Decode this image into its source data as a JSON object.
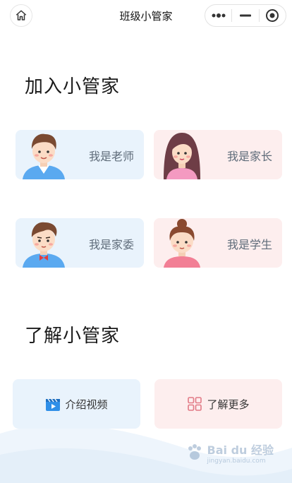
{
  "navbar": {
    "title": "班级小管家",
    "home_icon": "home-icon",
    "more_icon": "more-dots-icon",
    "minimize_icon": "minimize-icon",
    "close_icon": "target-close-icon"
  },
  "join_section": {
    "title": "加入小管家",
    "roles": [
      {
        "label": "我是老师",
        "avatar": "teacher-avatar",
        "theme": "blue"
      },
      {
        "label": "我是家长",
        "avatar": "parent-avatar",
        "theme": "pink"
      },
      {
        "label": "我是家委",
        "avatar": "committee-avatar",
        "theme": "blue"
      },
      {
        "label": "我是学生",
        "avatar": "student-avatar",
        "theme": "pink"
      }
    ]
  },
  "learn_section": {
    "title": "了解小管家",
    "video_label": "介绍视频",
    "more_label": "了解更多"
  },
  "watermark": {
    "text": "Bai du 经验",
    "subtext": "jingyan.baidu.com"
  },
  "colors": {
    "blue_card": "#e9f3fc",
    "pink_card": "#fdeeee",
    "accent_blue": "#3aa0f0",
    "accent_pink": "#e27a86"
  }
}
